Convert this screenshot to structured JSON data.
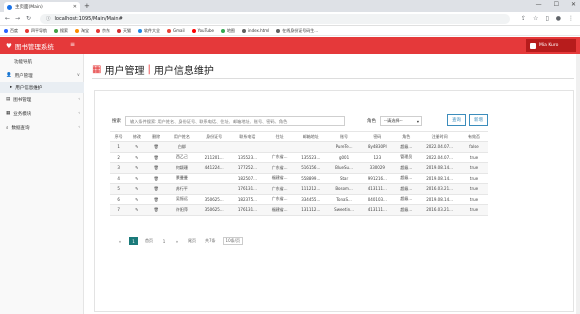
{
  "browser": {
    "tab_title": "主页面(Main)",
    "url": "localhost:1095/Main/Main#",
    "bookmarks": [
      "百度",
      "四平导航",
      "搜索",
      "淘宝",
      "京东",
      "天猫",
      "软件大全",
      "Gmail",
      "YouTube",
      "地图",
      "index.html",
      "在线身份证号码生..."
    ]
  },
  "app": {
    "title": "图书管理系统",
    "user": "Mia Kuro"
  },
  "sidebar": {
    "items": [
      {
        "label": "功能导航"
      },
      {
        "label": "用户管理"
      },
      {
        "label": "用户信息维护"
      },
      {
        "label": "图书管理"
      },
      {
        "label": "业务模块"
      },
      {
        "label": "数据查询"
      }
    ]
  },
  "page": {
    "title_main": "用户管理",
    "title_sep": "|",
    "title_sub": "用户信息维护"
  },
  "search": {
    "label": "搜索",
    "placeholder": "输入条件搜索: 用户姓名、身份证号、联系电话、住址、邮箱地址、账号、密码、角色",
    "role_label": "角色",
    "role_value": "--请选择--",
    "query_button": "查询",
    "add_button": "新增"
  },
  "table": {
    "headers": [
      "序号",
      "修改",
      "删除",
      "用户姓名",
      "身份证号",
      "联系电话",
      "住址",
      "邮箱地址",
      "账号",
      "密码",
      "角色",
      "注册时间",
      "有效否"
    ],
    "rows": [
      [
        "1",
        "✎",
        "🗑",
        "白绑",
        "",
        "",
        "",
        "",
        "PureTe...",
        "8y4830PI",
        "超级...",
        "2022.04.07...",
        "false"
      ],
      [
        "2",
        "✎",
        "🗑",
        "西乙己",
        "211201...",
        "135523...",
        "广东省...",
        "135523...",
        "g001",
        "123",
        "管理员",
        "2022.04.07...",
        "true"
      ],
      [
        "3",
        "✎",
        "🗑",
        "何颖珊",
        "441224...",
        "177252...",
        "广东省...",
        "516156...",
        "BlueSu...",
        "330029",
        "超级...",
        "2019.08.14...",
        "true"
      ],
      [
        "4",
        "✎",
        "🗑",
        "景曼曼",
        "",
        "182507...",
        "福建省...",
        "558899...",
        "Star",
        "991216...",
        "超级...",
        "2019.08.14...",
        "true"
      ],
      [
        "5",
        "✎",
        "🗑",
        "苏行平",
        "",
        "176131...",
        "广东省...",
        "111212...",
        "Bosom...",
        "413111...",
        "超级...",
        "2016.03.21...",
        "true"
      ],
      [
        "6",
        "✎",
        "🗑",
        "吴振远",
        "350625...",
        "182375...",
        "广东省...",
        "334455...",
        "TonaS...",
        "040103...",
        "超级...",
        "2019.08.14...",
        "true"
      ],
      [
        "7",
        "✎",
        "🗑",
        "许阳萍",
        "350625...",
        "176131...",
        "福建省...",
        "131112...",
        "Sweetin...",
        "413111...",
        "超级...",
        "2016.03.21...",
        "true"
      ]
    ]
  },
  "pager": {
    "first": "«",
    "current": "1",
    "prev_label": "首页",
    "page": "1",
    "next": "»",
    "last_label": "尾页",
    "total": "共7条",
    "per_page": "10条/页"
  }
}
